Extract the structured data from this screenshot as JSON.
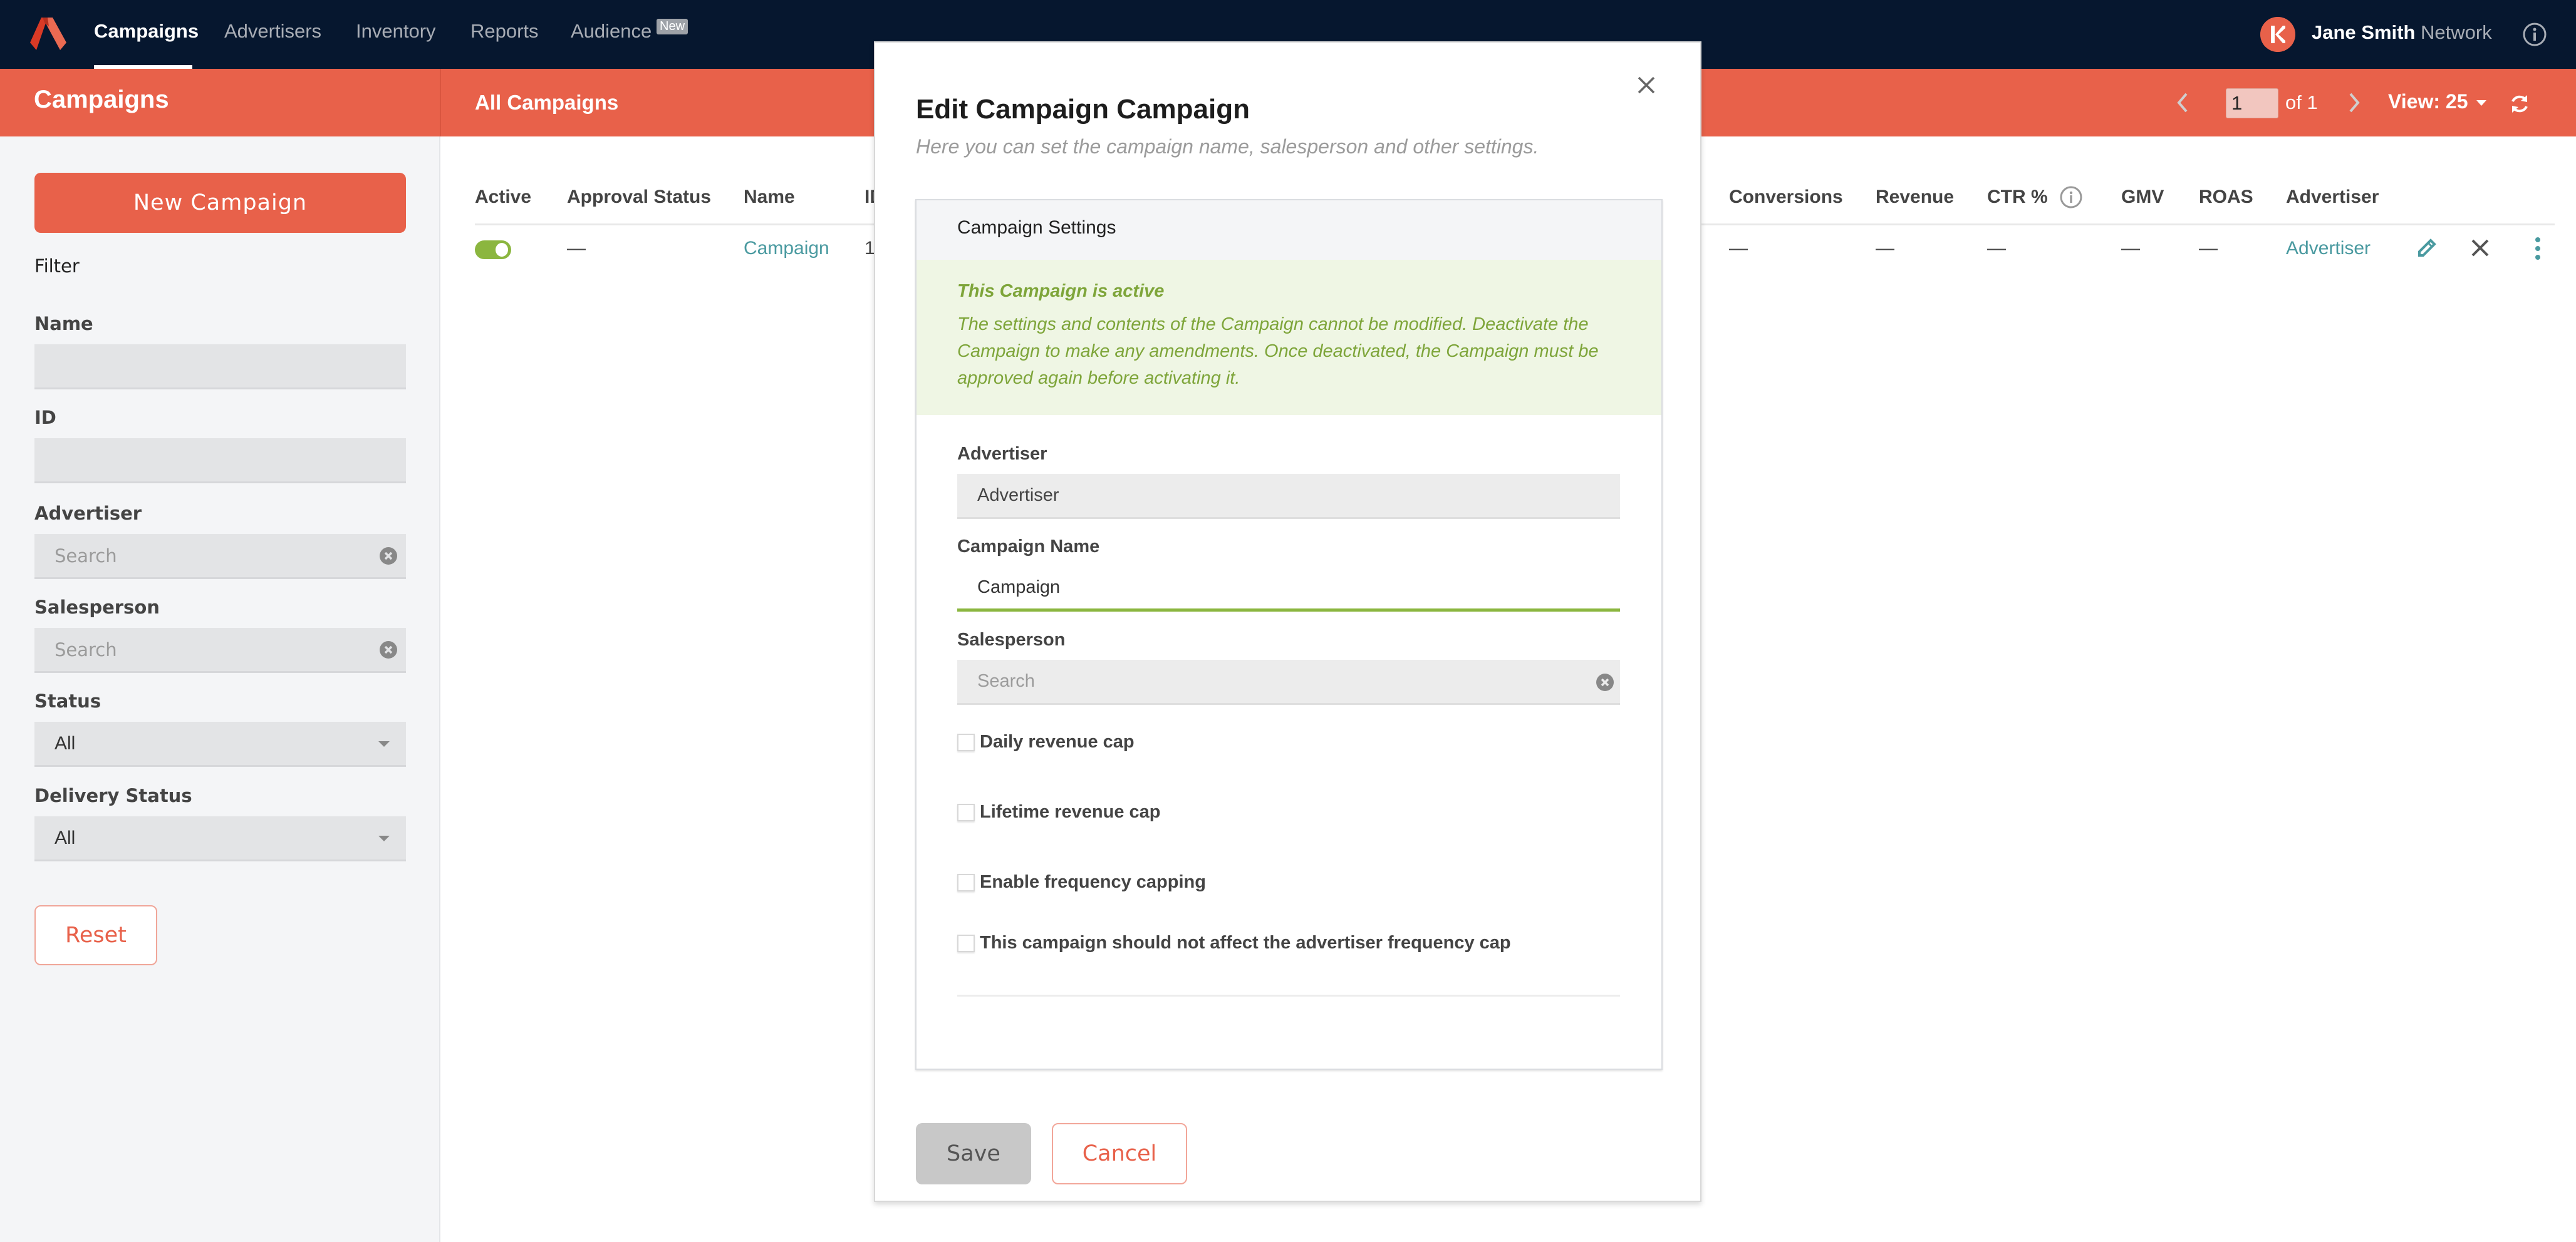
{
  "nav": {
    "items": [
      {
        "label": "Campaigns",
        "active": true
      },
      {
        "label": "Advertisers",
        "active": false
      },
      {
        "label": "Inventory",
        "active": false
      },
      {
        "label": "Reports",
        "active": false
      },
      {
        "label": "Audience",
        "active": false,
        "badge": "New"
      }
    ],
    "user": {
      "name": "Jane Smith",
      "network": "Network"
    },
    "brand_color": "#e8614a",
    "nav_bg": "#06172f"
  },
  "header": {
    "title": "Campaigns",
    "subtitle": "All Campaigns",
    "pager": {
      "page": "1",
      "of_label": "of 1"
    },
    "view_label": "View: 25"
  },
  "sidebar": {
    "new_button": "New Campaign",
    "filter_heading": "Filter",
    "filters": {
      "name": {
        "label": "Name",
        "value": ""
      },
      "id": {
        "label": "ID",
        "value": ""
      },
      "advertiser": {
        "label": "Advertiser",
        "placeholder": "Search"
      },
      "salesperson": {
        "label": "Salesperson",
        "placeholder": "Search"
      },
      "status": {
        "label": "Status",
        "value": "All"
      },
      "delivery_status": {
        "label": "Delivery Status",
        "value": "All"
      }
    },
    "reset_button": "Reset"
  },
  "table": {
    "columns": [
      "Active",
      "Approval Status",
      "Name",
      "ID",
      "Conversions",
      "Revenue",
      "CTR %",
      "GMV",
      "ROAS",
      "Advertiser"
    ],
    "rows": [
      {
        "active": true,
        "approval_status": "—",
        "name": "Campaign",
        "id": "1",
        "conversions": "—",
        "revenue": "—",
        "ctr": "—",
        "gmv": "—",
        "roas": "—",
        "advertiser": "Advertiser"
      }
    ]
  },
  "modal": {
    "title": "Edit Campaign Campaign",
    "subtitle": "Here you can set the campaign name, salesperson and other settings.",
    "panel_title": "Campaign Settings",
    "alert": {
      "title": "This Campaign is active",
      "body": "The settings and contents of the Campaign cannot be modified. Deactivate the Campaign to make any amendments. Once deactivated, the Campaign must be approved again before activating it."
    },
    "fields": {
      "advertiser": {
        "label": "Advertiser",
        "value": "Advertiser"
      },
      "campaign_name": {
        "label": "Campaign Name",
        "value": "Campaign"
      },
      "salesperson": {
        "label": "Salesperson",
        "placeholder": "Search"
      }
    },
    "checkboxes": [
      {
        "label": "Daily revenue cap",
        "checked": false
      },
      {
        "label": "Lifetime revenue cap",
        "checked": false
      },
      {
        "label": "Enable frequency capping",
        "checked": false
      },
      {
        "label": "This campaign should not affect the advertiser frequency cap",
        "checked": false
      }
    ],
    "save_label": "Save",
    "cancel_label": "Cancel"
  }
}
